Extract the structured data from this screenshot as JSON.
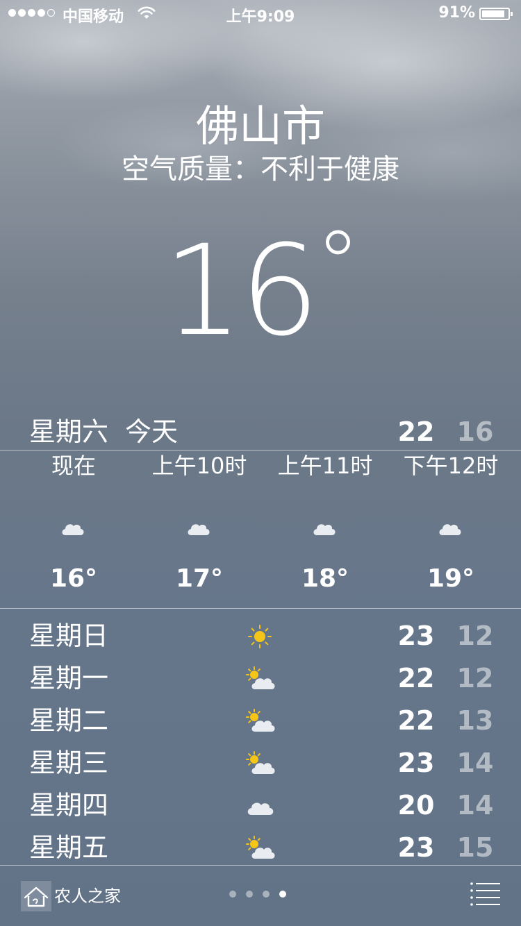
{
  "status_bar": {
    "carrier": "中国移动",
    "time": "上午9:09",
    "battery": "91%",
    "battery_level": 0.91
  },
  "location": {
    "city": "佛山市",
    "condition": "空气质量：不利于健康",
    "temperature": "16",
    "degree": "°"
  },
  "today": {
    "day": "星期六",
    "label": "今天",
    "high": "22",
    "low": "16"
  },
  "hourly": [
    {
      "time": "现在",
      "icon": "cloud-icon",
      "temp": "16°"
    },
    {
      "time": "上午10时",
      "icon": "cloud-icon",
      "temp": "17°"
    },
    {
      "time": "上午11时",
      "icon": "cloud-icon",
      "temp": "18°"
    },
    {
      "time": "下午12时",
      "icon": "cloud-icon",
      "temp": "19°"
    }
  ],
  "daily": [
    {
      "day": "星期日",
      "icon": "sun-icon",
      "high": "23",
      "low": "12"
    },
    {
      "day": "星期一",
      "icon": "partly-cloudy-icon",
      "high": "22",
      "low": "12"
    },
    {
      "day": "星期二",
      "icon": "partly-cloudy-icon",
      "high": "22",
      "low": "13"
    },
    {
      "day": "星期三",
      "icon": "partly-cloudy-icon",
      "high": "23",
      "low": "14"
    },
    {
      "day": "星期四",
      "icon": "cloud-icon",
      "high": "20",
      "low": "14"
    },
    {
      "day": "星期五",
      "icon": "partly-cloudy-icon",
      "high": "23",
      "low": "15"
    }
  ],
  "toolbar": {
    "watermark": "农人之家",
    "pages": 4,
    "active_page": 4
  },
  "colors": {
    "sun": "#f5c518",
    "cloud": "#e9ecf0"
  }
}
